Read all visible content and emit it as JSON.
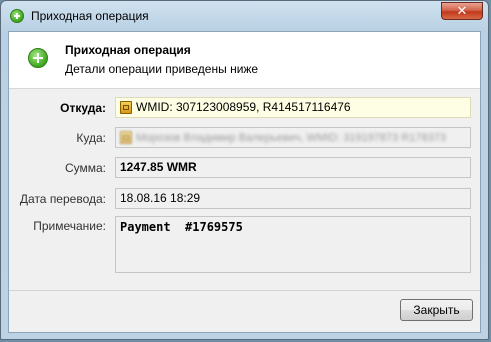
{
  "window": {
    "title": "Приходная операция",
    "close_label": "✕"
  },
  "header": {
    "title": "Приходная операция",
    "subtitle": "Детали операции приведены ниже"
  },
  "form": {
    "from": {
      "label": "Откуда:",
      "value": "WMID: 307123008959, R414517116476"
    },
    "to": {
      "label": "Куда:",
      "value": "Морозов Владимир Валерьевич, WMID: 319197873 R178373"
    },
    "amount": {
      "label": "Сумма:",
      "value": "1247.85 WMR"
    },
    "date": {
      "label": "Дата перевода:",
      "value": "18.08.16 18:29"
    },
    "note": {
      "label": "Примечание:",
      "value": "Payment  #1769575"
    }
  },
  "footer": {
    "close_button": "Закрыть"
  }
}
